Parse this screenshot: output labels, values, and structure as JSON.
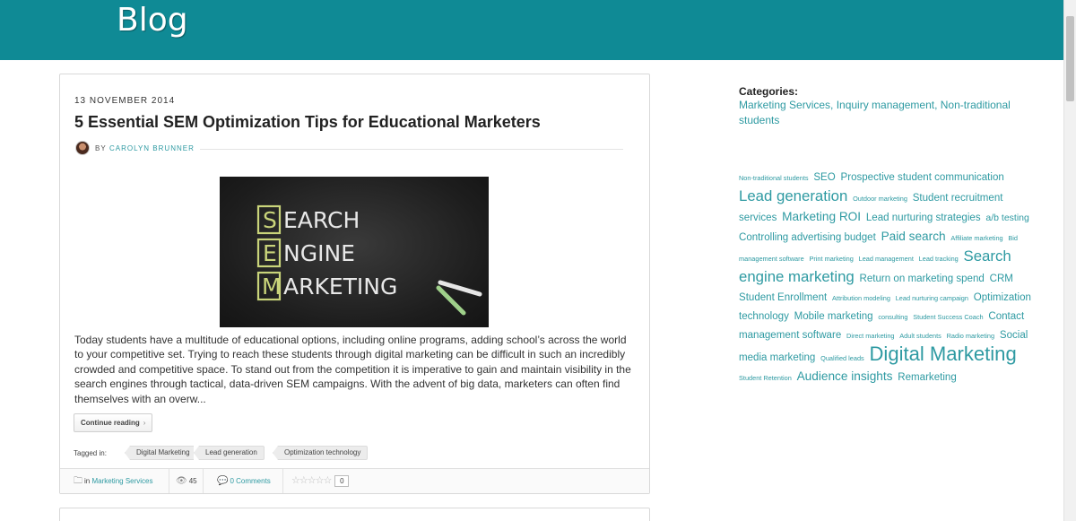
{
  "header": {
    "title": "Blog",
    "bg_color": "#0f8a95"
  },
  "post": {
    "date": "13 NOVEMBER 2014",
    "title": "5 Essential SEM Optimization Tips for Educational Marketers",
    "by": "BY",
    "author": "CAROLYN BRUNNER",
    "image": {
      "letters": [
        "S",
        "E",
        "M"
      ],
      "lines": [
        "EARCH",
        "NGINE",
        "ARKETING"
      ]
    },
    "excerpt": "Today students have a multitude of educational options, including online programs, adding school’s across the world to your competitive set. Trying to reach these students through digital marketing can be difficult in such an incredibly crowded and competitive space. To stand out from the competition it is imperative to gain and maintain visibility in the search engines through tactical, data-driven SEM campaigns. With the advent of big data, marketers can often find themselves with an overw...",
    "continue_label": "Continue reading",
    "continue_chevron": "›",
    "tagged_label": "Tagged in:",
    "tags": [
      "Digital Marketing",
      "Lead generation",
      "Optimization technology"
    ],
    "footer": {
      "in_label": "in",
      "category": "Marketing Services",
      "views": "45",
      "comments": "0 Comments",
      "stars": "☆☆☆☆☆",
      "rating_count": "0"
    }
  },
  "sidebar": {
    "categories_title": "Categories:",
    "categories": "Marketing Services, Inquiry management, Non-traditional students"
  },
  "tagcloud": [
    {
      "t": "Non-traditional students",
      "s": 7
    },
    {
      "t": "SEO",
      "s": 11
    },
    {
      "t": "Prospective student communication",
      "s": 11
    },
    {
      "t": "Lead generation",
      "s": 16
    },
    {
      "t": "Outdoor marketing",
      "s": 7
    },
    {
      "t": "Student recruitment services",
      "s": 11
    },
    {
      "t": "Marketing ROI",
      "s": 13
    },
    {
      "t": "Lead nurturing strategies",
      "s": 11
    },
    {
      "t": "a/b testing",
      "s": 10
    },
    {
      "t": "Controlling advertising budget",
      "s": 11
    },
    {
      "t": "Paid search",
      "s": 13
    },
    {
      "t": "Affiliate marketing",
      "s": 7
    },
    {
      "t": "Bid management software",
      "s": 7
    },
    {
      "t": "Print marketing",
      "s": 7
    },
    {
      "t": "Lead management",
      "s": 7
    },
    {
      "t": "Lead tracking",
      "s": 7
    },
    {
      "t": "Search engine marketing",
      "s": 16
    },
    {
      "t": "Return on marketing spend",
      "s": 11
    },
    {
      "t": "CRM",
      "s": 11
    },
    {
      "t": "Student Enrollment",
      "s": 11
    },
    {
      "t": "Attribution modeling",
      "s": 7
    },
    {
      "t": "Lead nurturing campaign",
      "s": 7
    },
    {
      "t": "Optimization technology",
      "s": 11
    },
    {
      "t": "Mobile marketing",
      "s": 11
    },
    {
      "t": "consulting",
      "s": 7
    },
    {
      "t": "Student Success Coach",
      "s": 7
    },
    {
      "t": "Contact management software",
      "s": 11
    },
    {
      "t": "Direct marketing",
      "s": 7
    },
    {
      "t": "Adult students",
      "s": 7
    },
    {
      "t": "Radio marketing",
      "s": 7
    },
    {
      "t": "Social media marketing",
      "s": 11
    },
    {
      "t": "Qualified leads",
      "s": 7
    },
    {
      "t": "Digital Marketing",
      "s": 21
    },
    {
      "t": "Student Retention",
      "s": 7
    },
    {
      "t": "Audience insights",
      "s": 13
    },
    {
      "t": "Remarketing",
      "s": 11
    }
  ]
}
